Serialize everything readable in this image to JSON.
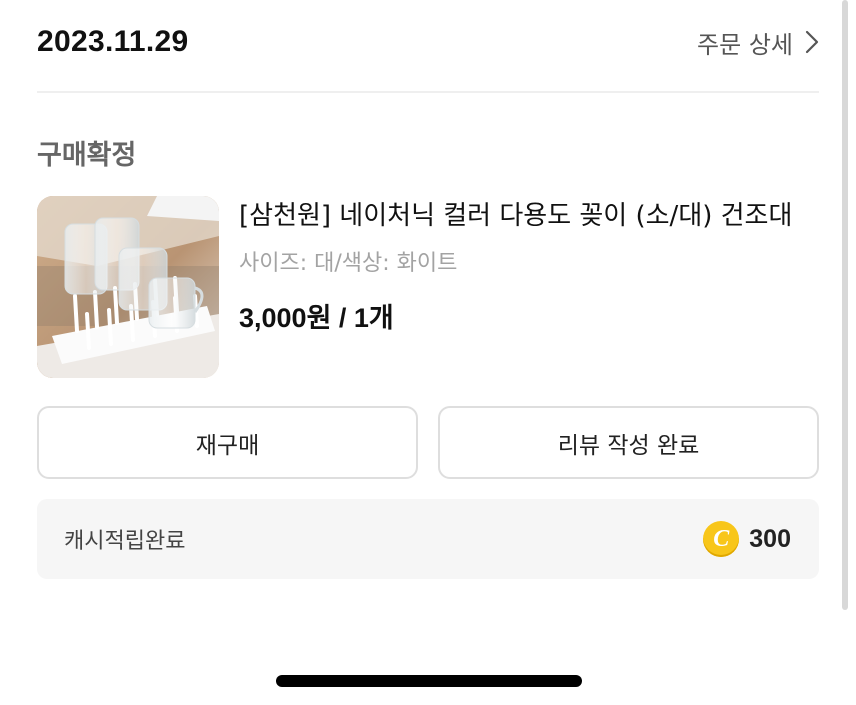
{
  "order": {
    "date": "2023.11.29",
    "detail_link": "주문 상세"
  },
  "status": "구매확정",
  "product": {
    "name": "[삼천원] 네이처닉 컬러 다용도 꽂이 (소/대) 건조대",
    "option": "사이즈: 대/색상: 화이트",
    "price": "3,000원 / 1개",
    "thumbnail_icon": "dish-drying-rack-photo"
  },
  "actions": {
    "rebuy_label": "재구매",
    "review_label": "리뷰 작성 완료"
  },
  "cashback": {
    "label": "캐시적립완료",
    "amount": "300",
    "coin_icon": "cash-coin-icon",
    "coin_letter": "C",
    "coin_color": "#f8c61a"
  }
}
